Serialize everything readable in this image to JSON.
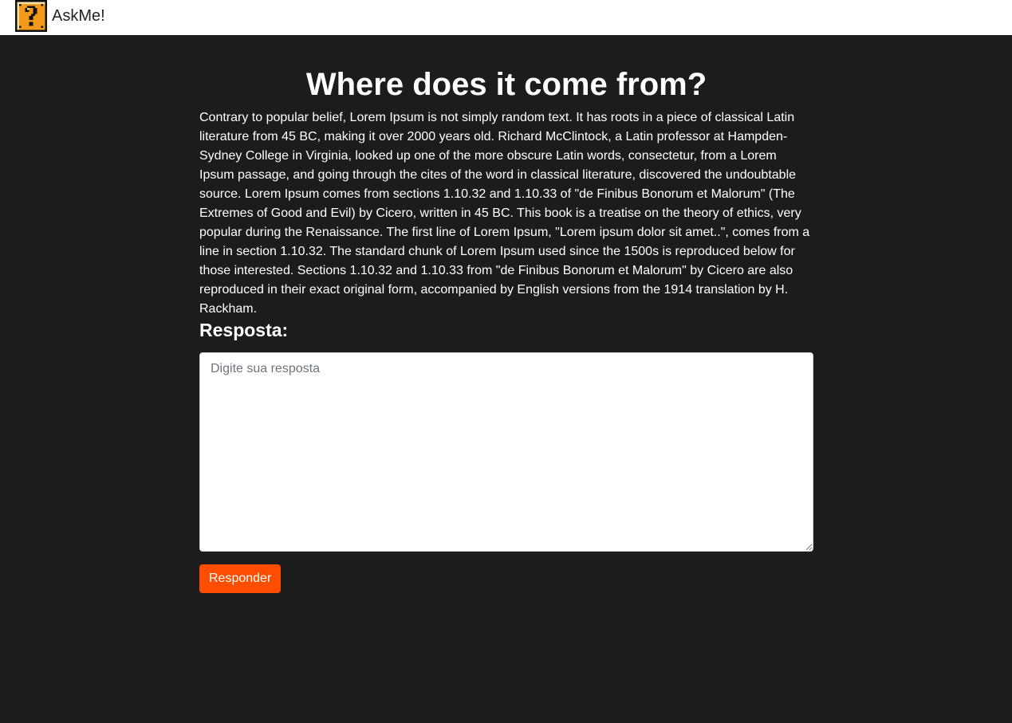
{
  "navbar": {
    "brand_name": "AskMe!",
    "logo_icon": "question-block-icon",
    "logo_colors": {
      "background": "#f39a1c",
      "border": "#111111",
      "mark": "#111111",
      "highlight": "#fde2a6"
    }
  },
  "question": {
    "title": "Where does it come from?",
    "body": "Contrary to popular belief, Lorem Ipsum is not simply random text. It has roots in a piece of classical Latin literature from 45 BC, making it over 2000 years old. Richard McClintock, a Latin professor at Hampden-Sydney College in Virginia, looked up one of the more obscure Latin words, consectetur, from a Lorem Ipsum passage, and going through the cites of the word in classical literature, discovered the undoubtable source. Lorem Ipsum comes from sections 1.10.32 and 1.10.33 of \"de Finibus Bonorum et Malorum\" (The Extremes of Good and Evil) by Cicero, written in 45 BC. This book is a treatise on the theory of ethics, very popular during the Renaissance. The first line of Lorem Ipsum, \"Lorem ipsum dolor sit amet..\", comes from a line in section 1.10.32. The standard chunk of Lorem Ipsum used since the 1500s is reproduced below for those interested. Sections 1.10.32 and 1.10.33 from \"de Finibus Bonorum et Malorum\" by Cicero are also reproduced in their exact original form, accompanied by English versions from the 1914 translation by H. Rackham."
  },
  "answer_form": {
    "label": "Resposta:",
    "input_value": "",
    "input_placeholder": "Digite sua resposta",
    "submit_label": "Responder"
  },
  "colors": {
    "page_background": "#1c1c1c",
    "navbar_background": "#ffffff",
    "accent": "#ff4d00",
    "text_light": "#ffffff"
  }
}
